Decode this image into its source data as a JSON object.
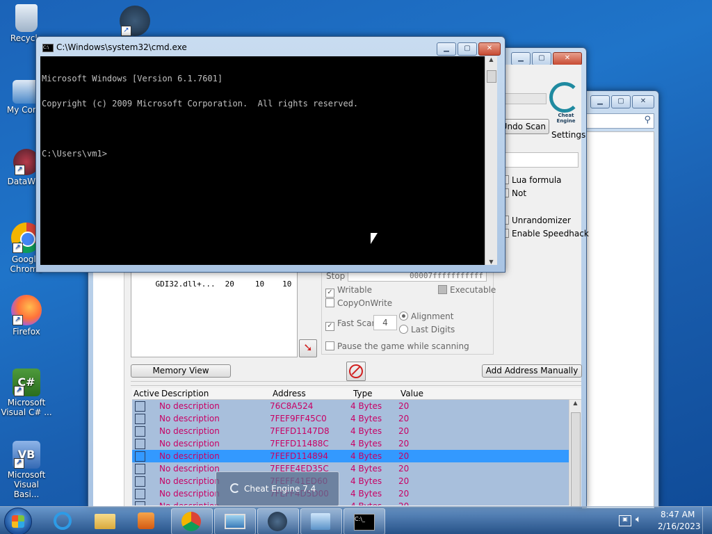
{
  "desktop": {
    "icons": [
      {
        "label": "Recycle"
      },
      {
        "label": "My Comp"
      },
      {
        "label": "DataWag"
      },
      {
        "label": "Google Chrome"
      },
      {
        "label": "Firefox"
      },
      {
        "label": "Microsoft Visual C# ..."
      },
      {
        "label": "Microsoft Visual Basi..."
      }
    ]
  },
  "cmd": {
    "title": "C:\\Windows\\system32\\cmd.exe",
    "lines": [
      "Microsoft Windows [Version 6.1.7601]",
      "Copyright (c) 2009 Microsoft Corporation.  All rights reserved.",
      "",
      "C:\\Users\\vm1>"
    ]
  },
  "cheat_engine": {
    "undo_scan": "Undo Scan",
    "settings": "Settings",
    "logo_text": "Cheat Engine",
    "lua_formula": "Lua formula",
    "not": "Not",
    "unrandomizer": "Unrandomizer",
    "enable_speedhack": "Enable Speedhack",
    "stop_label": "Stop",
    "stop_value": "00007fffffffffff",
    "writable": "Writable",
    "executable": "Executable",
    "copy_on_write": "CopyOnWrite",
    "fast_scan": "Fast Scan",
    "fast_scan_value": "4",
    "alignment": "Alignment",
    "last_digits": "Last Digits",
    "pause_game": "Pause the game while scanning",
    "process_row": {
      "name": "GDI32.dll+...",
      "a": "20",
      "b": "10",
      "c": "10"
    },
    "memory_view": "Memory View",
    "add_address": "Add Address Manually",
    "columns": {
      "active": "Active",
      "description": "Description",
      "address": "Address",
      "type": "Type",
      "value": "Value"
    },
    "rows": [
      {
        "description": "No description",
        "address": "76C8A524",
        "type": "4 Bytes",
        "value": "20"
      },
      {
        "description": "No description",
        "address": "7FEF9FF45C0",
        "type": "4 Bytes",
        "value": "20"
      },
      {
        "description": "No description",
        "address": "7FEFD1147D8",
        "type": "4 Bytes",
        "value": "20"
      },
      {
        "description": "No description",
        "address": "7FEFD11488C",
        "type": "4 Bytes",
        "value": "20"
      },
      {
        "description": "No description",
        "address": "7FEFD114894",
        "type": "4 Bytes",
        "value": "20"
      },
      {
        "description": "No description",
        "address": "7FEFE4ED35C",
        "type": "4 Bytes",
        "value": "20"
      },
      {
        "description": "No description",
        "address": "7FEFF41ED60",
        "type": "4 Bytes",
        "value": "20"
      },
      {
        "description": "No description",
        "address": "7FEFF4D5D00",
        "type": "4 Bytes",
        "value": "20"
      },
      {
        "description": "No description",
        "address": "",
        "type": "4 Bytes",
        "value": "20"
      }
    ],
    "selected_row": 4
  },
  "taskbar_tooltip": "Cheat Engine 7.4",
  "clock": {
    "time": "8:47 AM",
    "date": "2/16/2023"
  },
  "colors": {
    "accent": "#3399ff",
    "row_text": "#c80064",
    "cmd_bg": "#000000"
  }
}
